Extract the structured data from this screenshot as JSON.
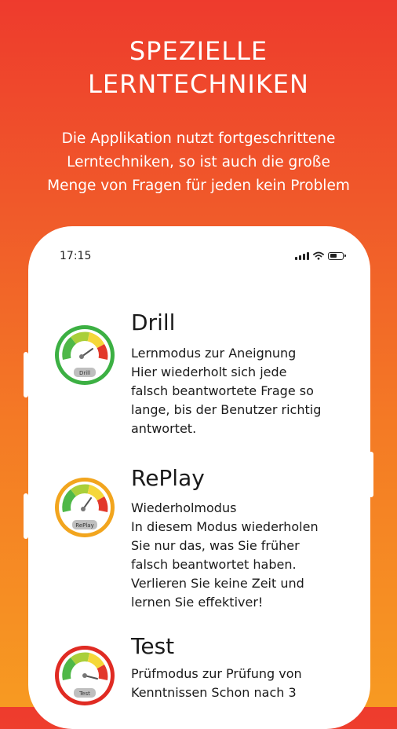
{
  "promo": {
    "headline_line1": "SPEZIELLE",
    "headline_line2": "LERNTECHNIKEN",
    "subtitle_line1": "Die Applikation nutzt fortgeschrittene",
    "subtitle_line2": "Lerntechniken, so ist auch die große",
    "subtitle_line3": "Menge von Fragen für jeden kein Problem"
  },
  "status_bar": {
    "time": "17:15"
  },
  "modes": [
    {
      "title": "Drill",
      "gauge_label": "Drill",
      "ring_color": "#3cb043",
      "description": "Lernmodus zur Aneignung\nHier wiederholt sich jede\nfalsch beantwortete Frage so\nlange, bis der Benutzer richtig\nantwortet."
    },
    {
      "title": "RePlay",
      "gauge_label": "RePlay",
      "ring_color": "#f2a51e",
      "description": "Wiederholmodus\nIn diesem Modus wiederholen\nSie nur das, was Sie früher\nfalsch beantwortet haben.\nVerlieren Sie keine Zeit und\nlernen Sie effektiver!"
    },
    {
      "title": "Test",
      "gauge_label": "Test",
      "ring_color": "#e02b23",
      "description": "Prüfmodus zur Prüfung von\nKenntnissen Schon nach 3"
    }
  ]
}
